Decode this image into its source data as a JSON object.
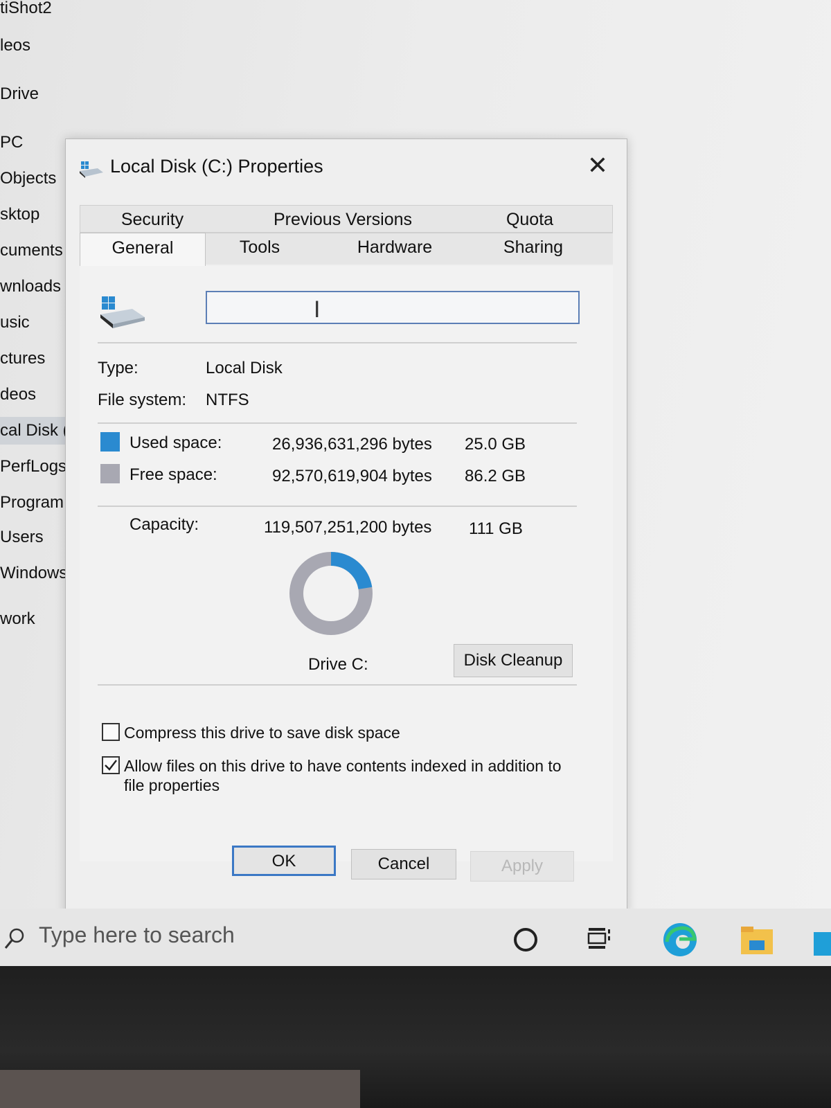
{
  "nav_pane": {
    "items": [
      {
        "label": "tiShot2",
        "selected": false
      },
      {
        "label": "leos",
        "selected": false
      },
      {
        "label": "Drive",
        "selected": false
      },
      {
        "label": " PC",
        "selected": false
      },
      {
        "label": " Objects",
        "selected": false
      },
      {
        "label": "sktop",
        "selected": false
      },
      {
        "label": "cuments",
        "selected": false
      },
      {
        "label": "wnloads",
        "selected": false
      },
      {
        "label": "usic",
        "selected": false
      },
      {
        "label": "ctures",
        "selected": false
      },
      {
        "label": "deos",
        "selected": false
      },
      {
        "label": "cal Disk (",
        "selected": true
      },
      {
        "label": "PerfLogs",
        "selected": false
      },
      {
        "label": "Program I",
        "selected": false
      },
      {
        "label": "Users",
        "selected": false
      },
      {
        "label": "Windows",
        "selected": false
      },
      {
        "label": "work",
        "selected": false
      }
    ]
  },
  "dialog": {
    "title": "Local Disk (C:) Properties",
    "close_glyph": "✕",
    "tabs": {
      "row1": [
        "Security",
        "Previous Versions",
        "Quota"
      ],
      "row2": [
        "General",
        "Tools",
        "Hardware",
        "Sharing"
      ],
      "active": "General"
    },
    "general": {
      "name_value": "",
      "type_label": "Type:",
      "type_value": "Local Disk",
      "fs_label": "File system:",
      "fs_value": "NTFS",
      "used_label": "Used space:",
      "used_bytes": "26,936,631,296 bytes",
      "used_gb": "25.0 GB",
      "free_label": "Free space:",
      "free_bytes": "92,570,619,904 bytes",
      "free_gb": "86.2 GB",
      "capacity_label": "Capacity:",
      "capacity_bytes": "119,507,251,200 bytes",
      "capacity_gb": "111 GB",
      "used_fraction": 0.225,
      "drive_label": "Drive C:",
      "disk_cleanup_label": "Disk Cleanup",
      "compress_label": "Compress this drive to save disk space",
      "compress_checked": false,
      "index_label_line1": "Allow files on this drive to have contents indexed in addition to",
      "index_label_line2": "file properties",
      "index_checked": true
    },
    "buttons": {
      "ok": "OK",
      "cancel": "Cancel",
      "apply": "Apply"
    }
  },
  "taskbar": {
    "search_placeholder": "Type here to search"
  },
  "colors": {
    "used": "#2a8ad0",
    "free": "#a8a8b2",
    "accent": "#3b78c5"
  }
}
